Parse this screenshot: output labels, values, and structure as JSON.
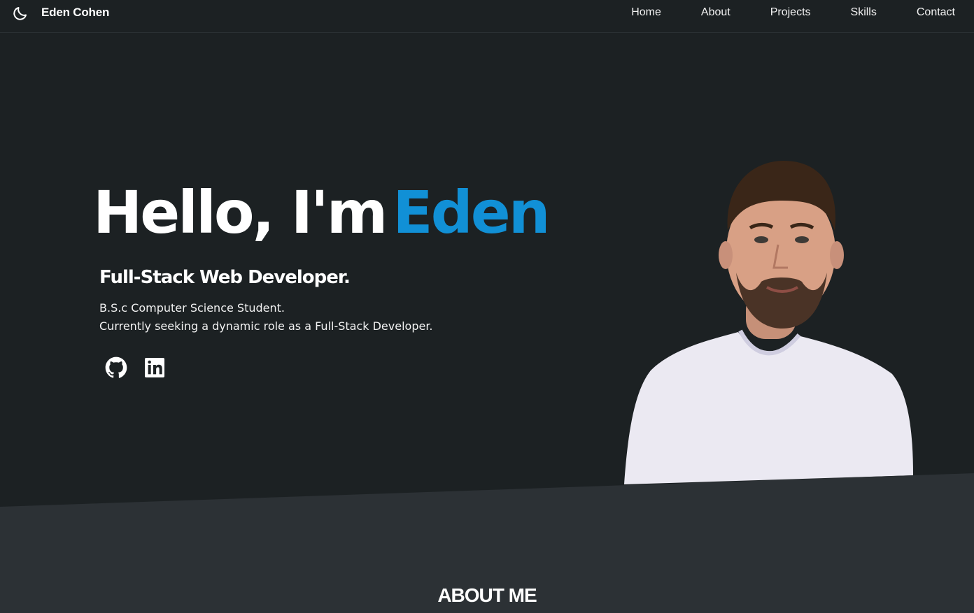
{
  "nav": {
    "brand": "Eden Cohen",
    "links": [
      "Home",
      "About",
      "Projects",
      "Skills",
      "Contact"
    ]
  },
  "hero": {
    "greeting": "Hello, I'm",
    "name": "Eden",
    "role": "Full-Stack Web Developer.",
    "lines": [
      "B.S.c Computer Science Student.",
      "Currently seeking a dynamic role as a Full-Stack Developer."
    ]
  },
  "social": {
    "icons": [
      "github-icon",
      "linkedin-icon"
    ]
  },
  "about": {
    "title": "ABOUT ME"
  },
  "colors": {
    "background": "#1c2123",
    "section_background": "#2c3135",
    "accent": "#1190d6",
    "text": "#ffffff"
  },
  "icons": {
    "theme_toggle": "moon-icon"
  }
}
